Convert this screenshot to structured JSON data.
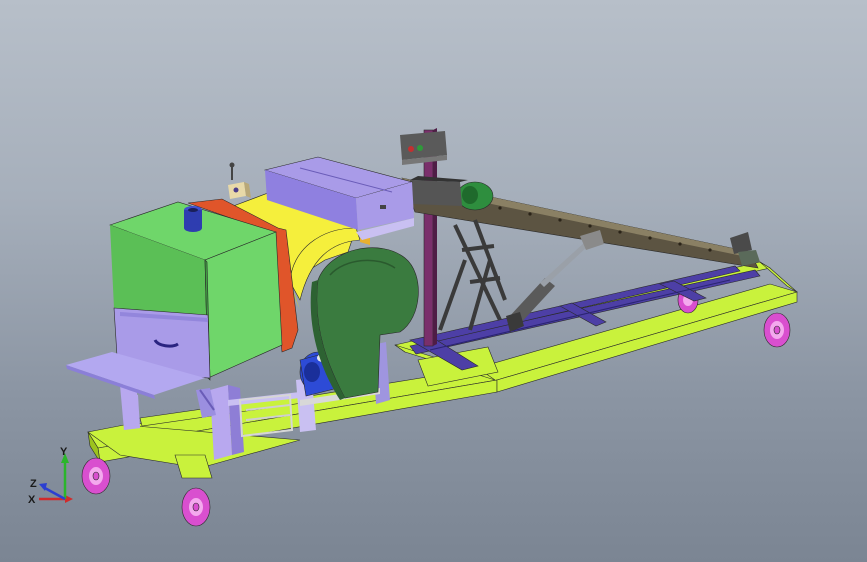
{
  "view": {
    "background_top": "#b7bfc9",
    "background_bottom": "#7b8593"
  },
  "colors": {
    "frame": "#c9f23c",
    "frame_dark": "#9cc21e",
    "hopper_green": "#6fd66a",
    "hopper_green_dark": "#3f9d42",
    "purple": "#a99be8",
    "purple_dark": "#7d6fc4",
    "yellow": "#f5ef3c",
    "orange_red": "#e0552a",
    "guard_green": "#3a7b3f",
    "rail_purple": "#4d3fa6",
    "conveyor_brown": "#5c5442",
    "wheel_magenta": "#d94fcf",
    "motor_blue": "#2d4bd6",
    "motor_green": "#2e8e3e",
    "post_purple": "#7a2f6b",
    "triad_x": "#d12b2b",
    "triad_y": "#2bb52b",
    "triad_z": "#2b3fd1"
  },
  "triad": {
    "x_label": "X",
    "y_label": "Y",
    "z_label": "Z"
  }
}
